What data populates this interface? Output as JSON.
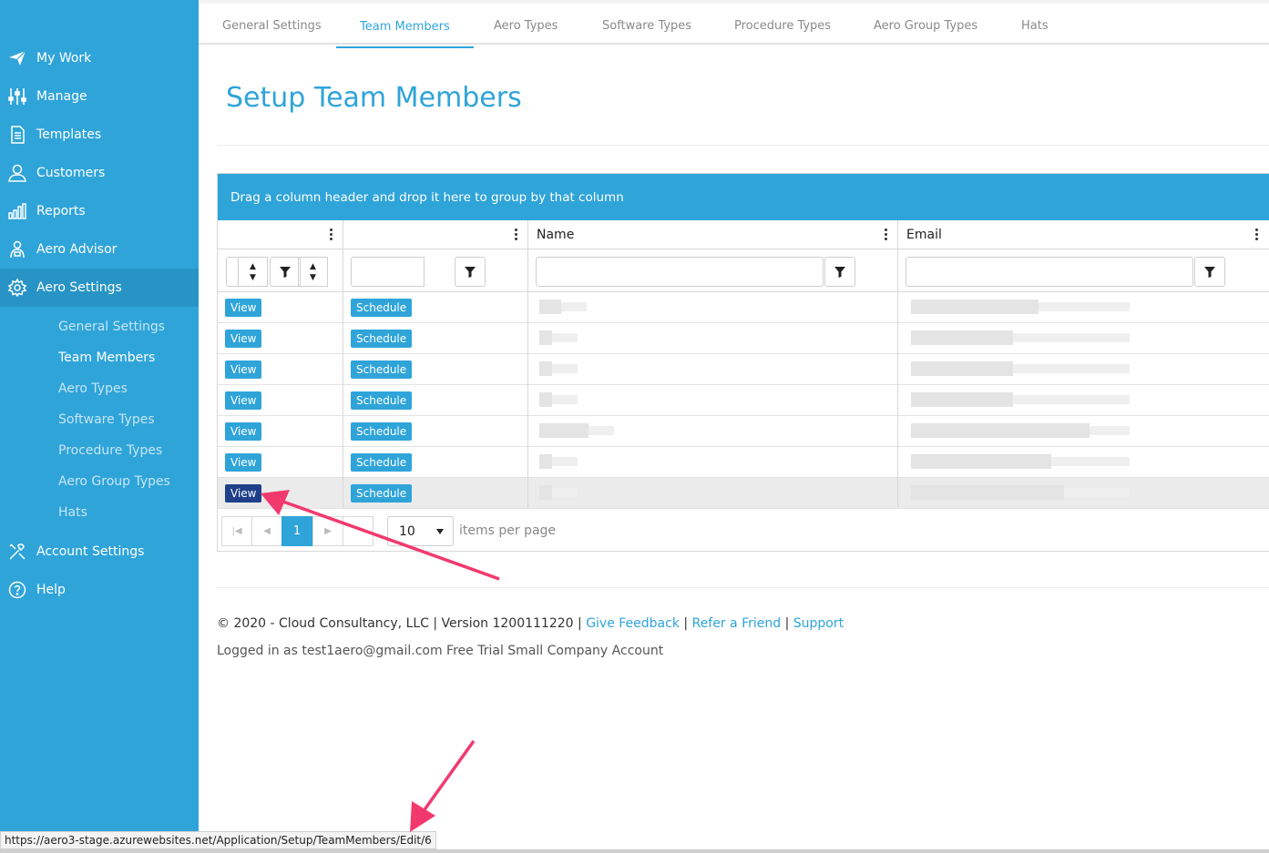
{
  "sidebar": {
    "items": [
      {
        "label": "My Work",
        "icon": "paper-plane-icon"
      },
      {
        "label": "Manage",
        "icon": "sliders-icon"
      },
      {
        "label": "Templates",
        "icon": "document-icon"
      },
      {
        "label": "Customers",
        "icon": "user-icon"
      },
      {
        "label": "Reports",
        "icon": "bar-chart-icon"
      },
      {
        "label": "Aero Advisor",
        "icon": "advisor-icon"
      },
      {
        "label": "Aero Settings",
        "icon": "gear-icon"
      },
      {
        "label": "Account Settings",
        "icon": "tools-icon"
      },
      {
        "label": "Help",
        "icon": "question-circle-icon"
      }
    ],
    "sub_items": [
      "General Settings",
      "Team Members",
      "Aero Types",
      "Software Types",
      "Procedure Types",
      "Aero Group Types",
      "Hats"
    ]
  },
  "tabs": [
    "General Settings",
    "Team Members",
    "Aero Types",
    "Software Types",
    "Procedure Types",
    "Aero Group Types",
    "Hats"
  ],
  "page_title": "Setup Team Members",
  "grid": {
    "group_hint": "Drag a column header and drop it here to group by that column",
    "columns": [
      "",
      "",
      "Name",
      "Email"
    ],
    "view_label": "View",
    "schedule_label": "Schedule",
    "row_count": 7,
    "pager": {
      "current_page": "1",
      "page_size": "10",
      "items_per_page_label": "items per page"
    }
  },
  "footer": {
    "copyright": "© 2020 - Cloud Consultancy, LLC | Version 1200111220 |",
    "give_feedback": "Give Feedback",
    "refer_friend": "Refer a Friend",
    "support": "Support",
    "sep": "|",
    "logged_in": "Logged in as test1aero@gmail.com Free Trial Small Company Account"
  },
  "status_url": "https://aero3-stage.azurewebsites.net/Application/Setup/TeamMembers/Edit/6",
  "colors": {
    "accent": "#2fa4d9",
    "selected_button": "#1f3f8a",
    "annotation_arrow": "#f2396e"
  }
}
